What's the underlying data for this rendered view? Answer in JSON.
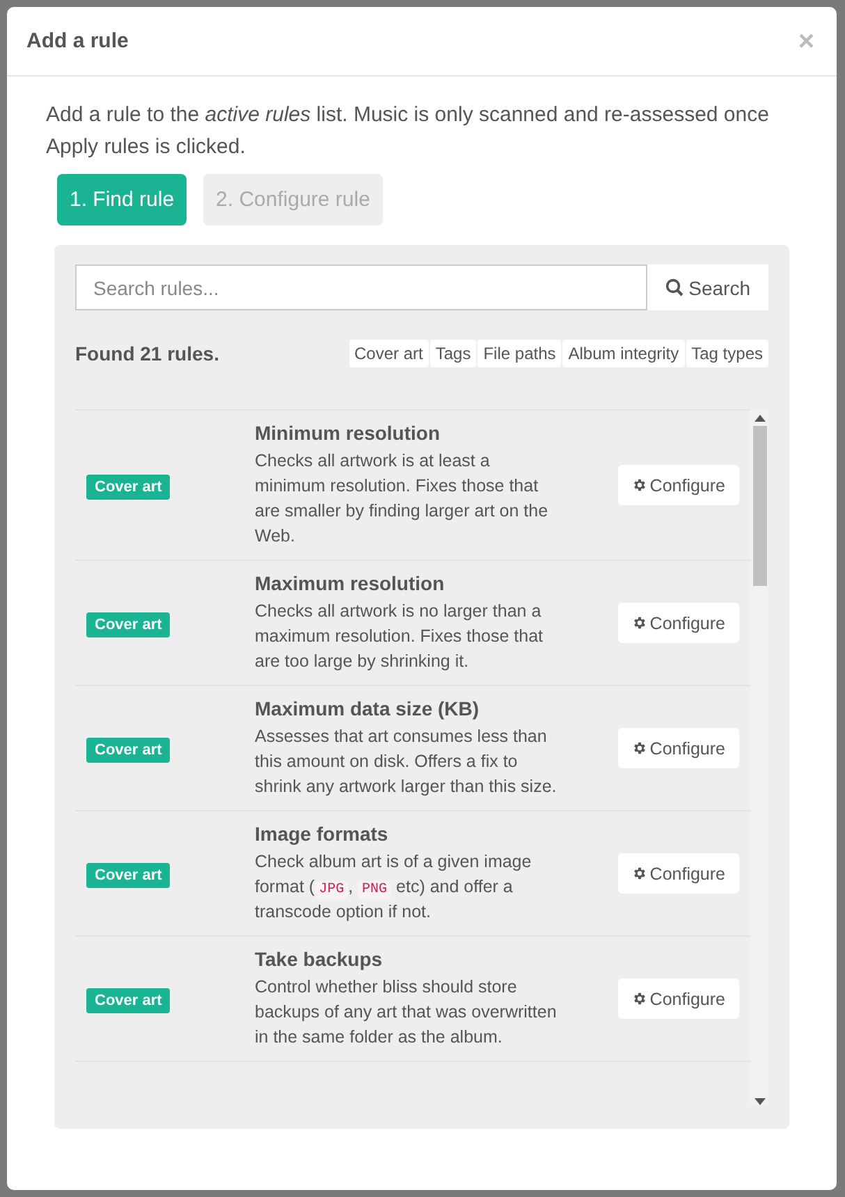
{
  "dialog": {
    "title": "Add a rule",
    "close": "×"
  },
  "intro": "Add a rule to the *active rules* list. Music is only scanned and re-assessed once Apply rules is clicked.",
  "steps": [
    {
      "label": "1. Find rule",
      "selected": true
    },
    {
      "label": "2. Configure rule",
      "selected": false
    }
  ],
  "search": {
    "placeholder": "Search rules...",
    "button": "Search"
  },
  "found": "Found 21 rules.",
  "filters": [
    "Cover art",
    "Tags",
    "File paths",
    "Album integrity",
    "Tag types"
  ],
  "rules": [
    {
      "tag": "Cover art",
      "title": "Minimum resolution",
      "description": [
        {
          "kind": "text",
          "text": "Checks all artwork is at least a minimum resolution. Fixes those that are smaller by finding larger art on the Web."
        }
      ],
      "button": "Configure"
    },
    {
      "tag": "Cover art",
      "title": "Maximum resolution",
      "description": [
        {
          "kind": "text",
          "text": "Checks all artwork is no larger than a maximum resolution. Fixes those that are too large by shrinking it."
        }
      ],
      "button": "Configure"
    },
    {
      "tag": "Cover art",
      "title": "Maximum data size (KB)",
      "description": [
        {
          "kind": "text",
          "text": "Assesses that art consumes less than this amount on disk. Offers a fix to shrink any artwork larger than this size."
        }
      ],
      "button": "Configure"
    },
    {
      "tag": "Cover art",
      "title": "Image formats",
      "description": [
        {
          "kind": "text",
          "text": "Check album art is of a given image format ("
        },
        {
          "kind": "code",
          "text": "JPG"
        },
        {
          "kind": "text",
          "text": ", "
        },
        {
          "kind": "code",
          "text": "PNG"
        },
        {
          "kind": "text",
          "text": " etc) and offer a transcode option if not."
        }
      ],
      "button": "Configure"
    },
    {
      "tag": "Cover art",
      "title": "Take backups",
      "description": [
        {
          "kind": "text",
          "text": "Control whether bliss should store backups of any art that was overwritten in the same folder as the album."
        }
      ],
      "button": "Configure"
    }
  ]
}
